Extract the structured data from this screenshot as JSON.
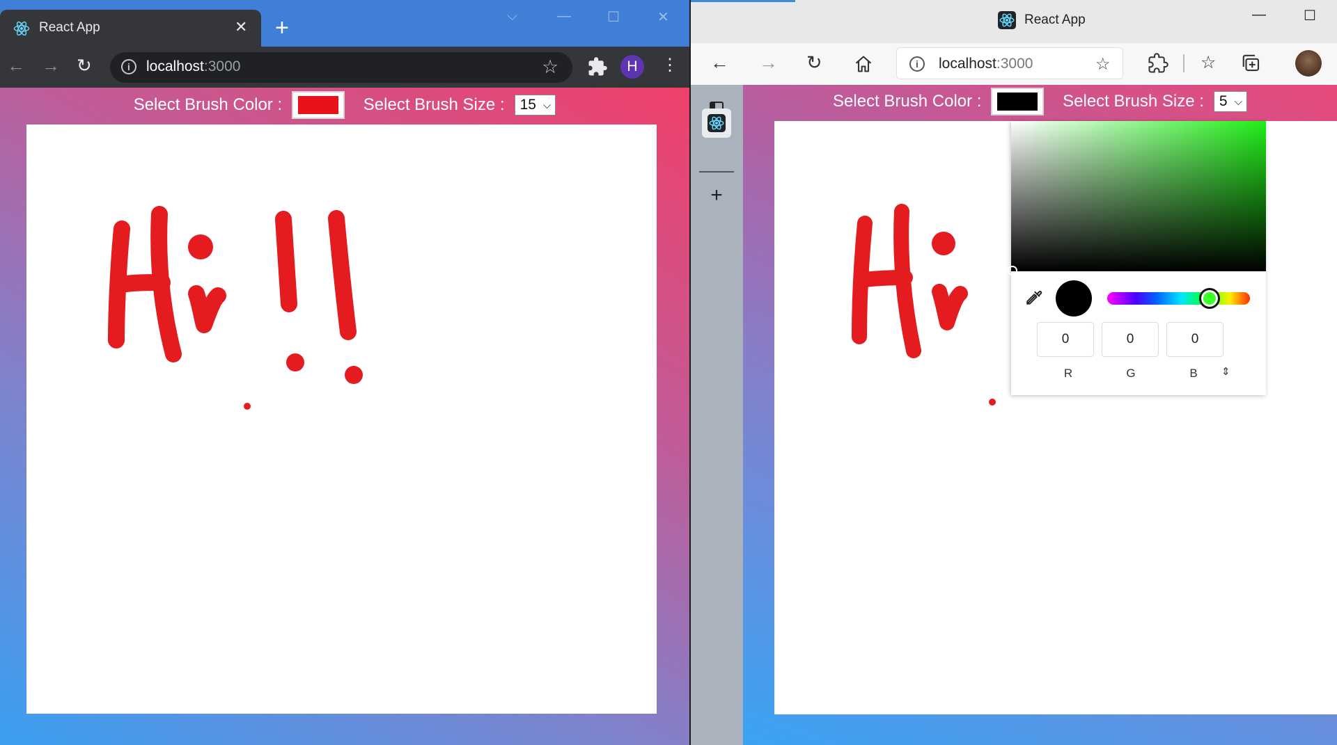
{
  "colors": {
    "left_brush": "#e8121a",
    "right_brush": "#000000",
    "stroke": "#e41b1f"
  },
  "left_window": {
    "tab_title": "React App",
    "url_host": "localhost",
    "url_port": ":3000",
    "avatar_letter": "H",
    "app": {
      "color_label": "Select Brush Color :",
      "size_label": "Select Brush Size :",
      "size_value": "15"
    }
  },
  "right_window": {
    "title": "React App",
    "url_host": "localhost",
    "url_port": ":3000",
    "app": {
      "color_label": "Select Brush Color :",
      "size_label": "Select Brush Size :",
      "size_value": "5"
    },
    "picker": {
      "r": "0",
      "g": "0",
      "b": "0",
      "r_label": "R",
      "g_label": "G",
      "b_label": "B"
    }
  }
}
